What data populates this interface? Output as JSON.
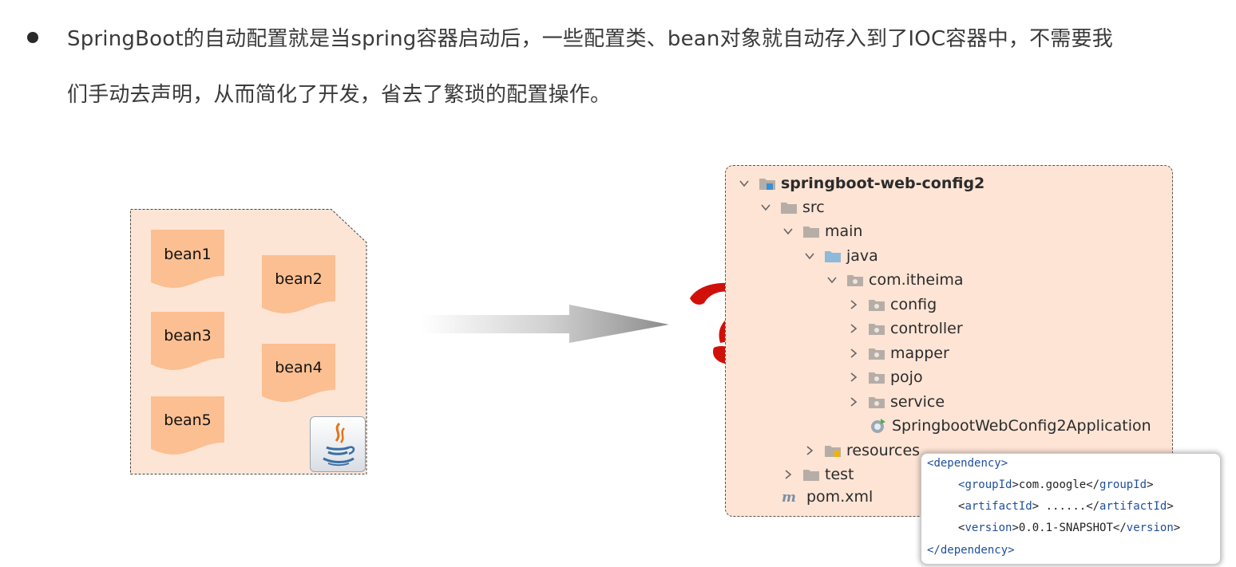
{
  "paragraph": {
    "line1": "SpringBoot的自动配置就是当spring容器启动后，一些配置类、bean对象就自动存入到了IOC容器中，不需要我",
    "line2": "们手动去声明，从而简化了开发，省去了繁琐的配置操作。"
  },
  "beans": [
    "bean1",
    "bean2",
    "bean3",
    "bean4",
    "bean5"
  ],
  "icons": {
    "java": "java-coffee-icon",
    "question": "question-mark-icon",
    "arrow": "gradient-arrow-icon",
    "cursor": "mouse-cursor-icon"
  },
  "colors": {
    "bean_fill": "#fbbf92",
    "container_fill": "#fde5d6",
    "question_red": "#d0110a",
    "xml_tag": "#1f4e9c"
  },
  "tree": {
    "root": "springboot-web-config2",
    "src": "src",
    "main": "main",
    "java": "java",
    "package": "com.itheima",
    "config": "config",
    "controller": "controller",
    "mapper": "mapper",
    "pojo": "pojo",
    "service": "service",
    "app_class": "SpringbootWebConfig2Application",
    "resources": "resources",
    "test": "test",
    "pom": "pom.xml"
  },
  "xml": {
    "dependency_tag": "dependency",
    "group_tag": "groupId",
    "group_value": "com.google",
    "artifact_tag": "artifactId",
    "artifact_value": " ......",
    "version_tag": "version",
    "version_value": "0.0.1-SNAPSHOT"
  }
}
